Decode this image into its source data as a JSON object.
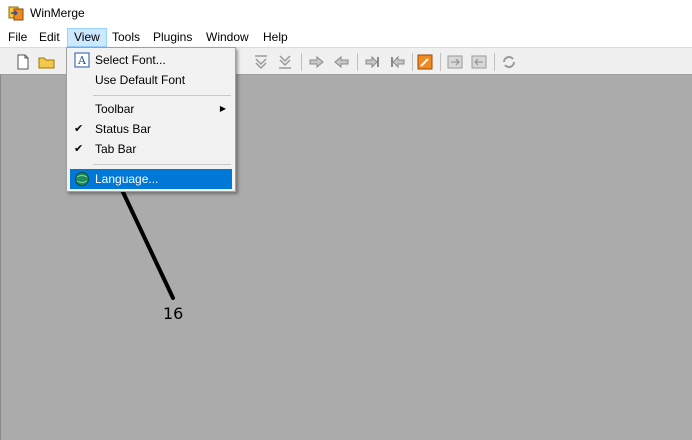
{
  "window": {
    "title": "WinMerge"
  },
  "menubar": {
    "items": [
      {
        "label": "File"
      },
      {
        "label": "Edit"
      },
      {
        "label": "View"
      },
      {
        "label": "Tools"
      },
      {
        "label": "Plugins"
      },
      {
        "label": "Window"
      },
      {
        "label": "Help"
      }
    ]
  },
  "view_menu": {
    "items": [
      {
        "label": "Select Font...",
        "icon": "font-icon"
      },
      {
        "label": "Use Default Font"
      },
      {
        "label": "Toolbar",
        "submenu": true
      },
      {
        "label": "Status Bar",
        "checked": true
      },
      {
        "label": "Tab Bar",
        "checked": true
      },
      {
        "label": "Language...",
        "icon": "globe-icon",
        "highlighted": true
      }
    ]
  },
  "callout": {
    "number": "16"
  },
  "colors": {
    "workspace": "#ababab",
    "highlight": "#0078d7",
    "menu_active": "#cce8ff"
  }
}
